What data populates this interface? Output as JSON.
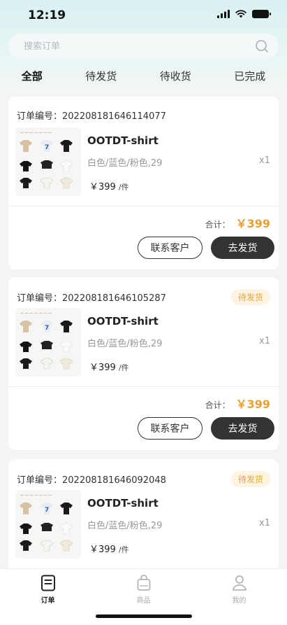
{
  "status_bar": {
    "time": "12:19"
  },
  "search": {
    "placeholder": "搜索订单",
    "icon": "search-icon"
  },
  "tabs": [
    {
      "label": "全部",
      "active": true
    },
    {
      "label": "待发货",
      "active": false
    },
    {
      "label": "待收货",
      "active": false
    },
    {
      "label": "已完成",
      "active": false
    }
  ],
  "orders": [
    {
      "order_label": "订单编号：",
      "order_no": "202208181646114077",
      "status": "",
      "product_title": "OOTDT-shirt",
      "spec": "白色/蓝色/粉色,29",
      "quantity": "x1",
      "price": "￥399",
      "price_unit": "/件",
      "total_label": "合计：",
      "total": "￥399",
      "contact_label": "联系客户",
      "ship_label": "去发货"
    },
    {
      "order_label": "订单编号：",
      "order_no": "202208181646105287",
      "status": "待发货",
      "product_title": "OOTDT-shirt",
      "spec": "白色/蓝色/粉色,29",
      "quantity": "x1",
      "price": "￥399",
      "price_unit": "/件",
      "total_label": "合计：",
      "total": "￥399",
      "contact_label": "联系客户",
      "ship_label": "去发货"
    },
    {
      "order_label": "订单编号：",
      "order_no": "202208181646092048",
      "status": "待发货",
      "product_title": "OOTDT-shirt",
      "spec": "白色/蓝色/粉色,29",
      "quantity": "x1",
      "price": "￥399",
      "price_unit": "/件",
      "total_label": "",
      "total": "",
      "contact_label": "",
      "ship_label": ""
    }
  ],
  "tabbar": [
    {
      "label": "订单",
      "icon": "order-icon",
      "active": true
    },
    {
      "label": "商品",
      "icon": "bag-icon",
      "active": false
    },
    {
      "label": "我的",
      "icon": "user-icon",
      "active": false
    }
  ],
  "colors": {
    "accent_price": "#e8a030",
    "badge_text": "#e8a33c",
    "badge_bg": "#fff4e2",
    "primary_button": "#333333",
    "header_gradient_top": "#d9f0f1"
  }
}
